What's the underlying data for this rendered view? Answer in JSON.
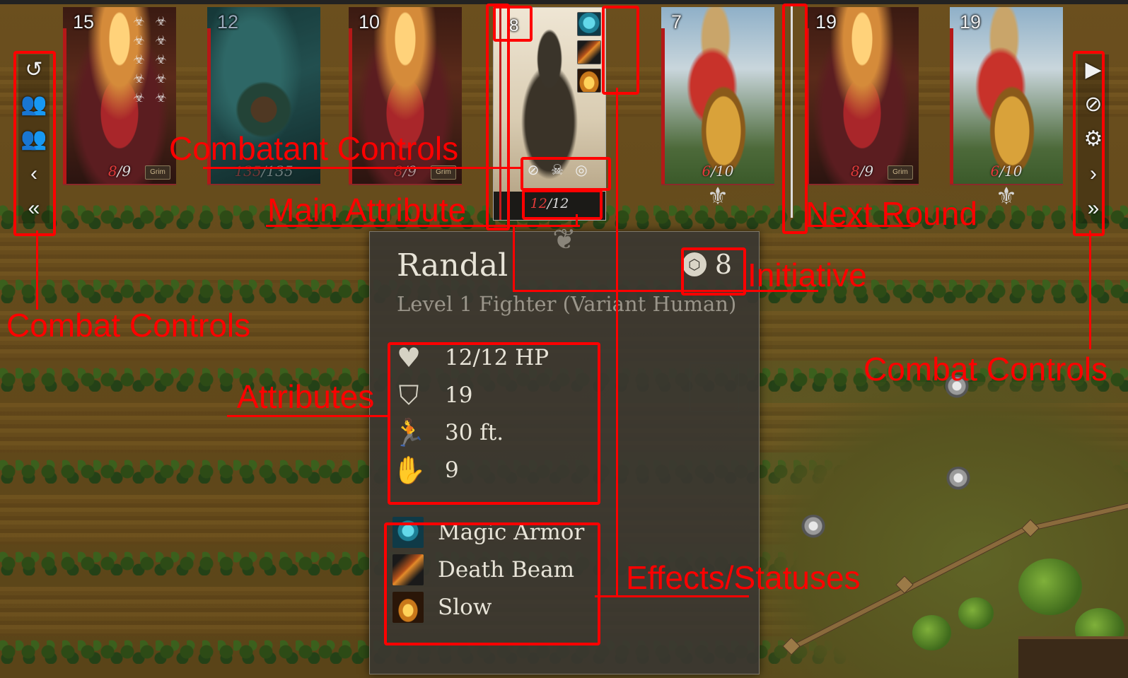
{
  "combatants": [
    {
      "initiative": "15",
      "hp_current": "8",
      "hp_max": "9",
      "conditions": [
        "☣",
        "☣",
        "☣",
        "☣",
        "☣",
        "☣",
        "☣",
        "☣",
        "☣",
        "☣"
      ],
      "badge": "Grim"
    },
    {
      "initiative": "12",
      "hp_current": "135",
      "hp_max": "135"
    },
    {
      "initiative": "10",
      "hp_current": "8",
      "hp_max": "9",
      "badge": "Grim"
    },
    {
      "initiative": "8",
      "hp_current": "12",
      "hp_max": "12",
      "effects": [
        "Magic Armor",
        "Death Beam",
        "Slow"
      ],
      "controls": [
        {
          "icon": "eye-slash-icon",
          "glyph": "⊘"
        },
        {
          "icon": "skull-icon",
          "glyph": "☠"
        },
        {
          "icon": "target-icon",
          "glyph": "◎"
        }
      ]
    },
    {
      "initiative": "7",
      "hp_current": "6",
      "hp_max": "10",
      "flourish": "⚜"
    },
    {
      "initiative": "19",
      "hp_current": "8",
      "hp_max": "9",
      "badge": "Grim"
    },
    {
      "initiative": "19",
      "hp_current": "6",
      "hp_max": "10",
      "flourish": "⚜"
    }
  ],
  "left_controls": [
    {
      "icon": "undo-icon",
      "glyph": "↺"
    },
    {
      "icon": "group-icon",
      "glyph": "👥"
    },
    {
      "icon": "group-settings-icon",
      "glyph": "👥"
    },
    {
      "icon": "chevron-left-icon",
      "glyph": "‹"
    },
    {
      "icon": "double-chevron-left-icon",
      "glyph": "«"
    }
  ],
  "right_controls": [
    {
      "icon": "play-icon",
      "glyph": "▶"
    },
    {
      "icon": "ban-icon",
      "glyph": "⊘"
    },
    {
      "icon": "gear-icon",
      "glyph": "⚙"
    },
    {
      "icon": "chevron-right-icon",
      "glyph": "›"
    },
    {
      "icon": "double-chevron-right-icon",
      "glyph": "»"
    }
  ],
  "details": {
    "name": "Randal",
    "subtitle": "Level 1 Fighter (Variant Human)",
    "initiative": "8",
    "attributes": [
      {
        "icon": "heart-icon",
        "glyph": "♥",
        "value": "12/12 HP"
      },
      {
        "icon": "shield-icon",
        "glyph": "⛉",
        "value": "19"
      },
      {
        "icon": "running-icon",
        "glyph": "🏃",
        "value": "30 ft."
      },
      {
        "icon": "hand-icon",
        "glyph": "✋",
        "value": "9"
      }
    ],
    "effects": [
      {
        "icon": "magic-armor-icon",
        "label": "Magic Armor"
      },
      {
        "icon": "death-beam-icon",
        "label": "Death Beam"
      },
      {
        "icon": "slow-icon",
        "label": "Slow"
      }
    ]
  },
  "annotations": {
    "combatant_controls": "Combatant Controls",
    "main_attribute": "Main Attribute",
    "next_round": "Next Round",
    "initiative": "Initiative",
    "combat_controls_left": "Combat Controls",
    "combat_controls_right": "Combat Controls",
    "attributes": "Attributes",
    "effects_statuses": "Effects/Statuses"
  },
  "colors": {
    "annotation": "#ff0000",
    "hp_current": "#e23a3a"
  }
}
